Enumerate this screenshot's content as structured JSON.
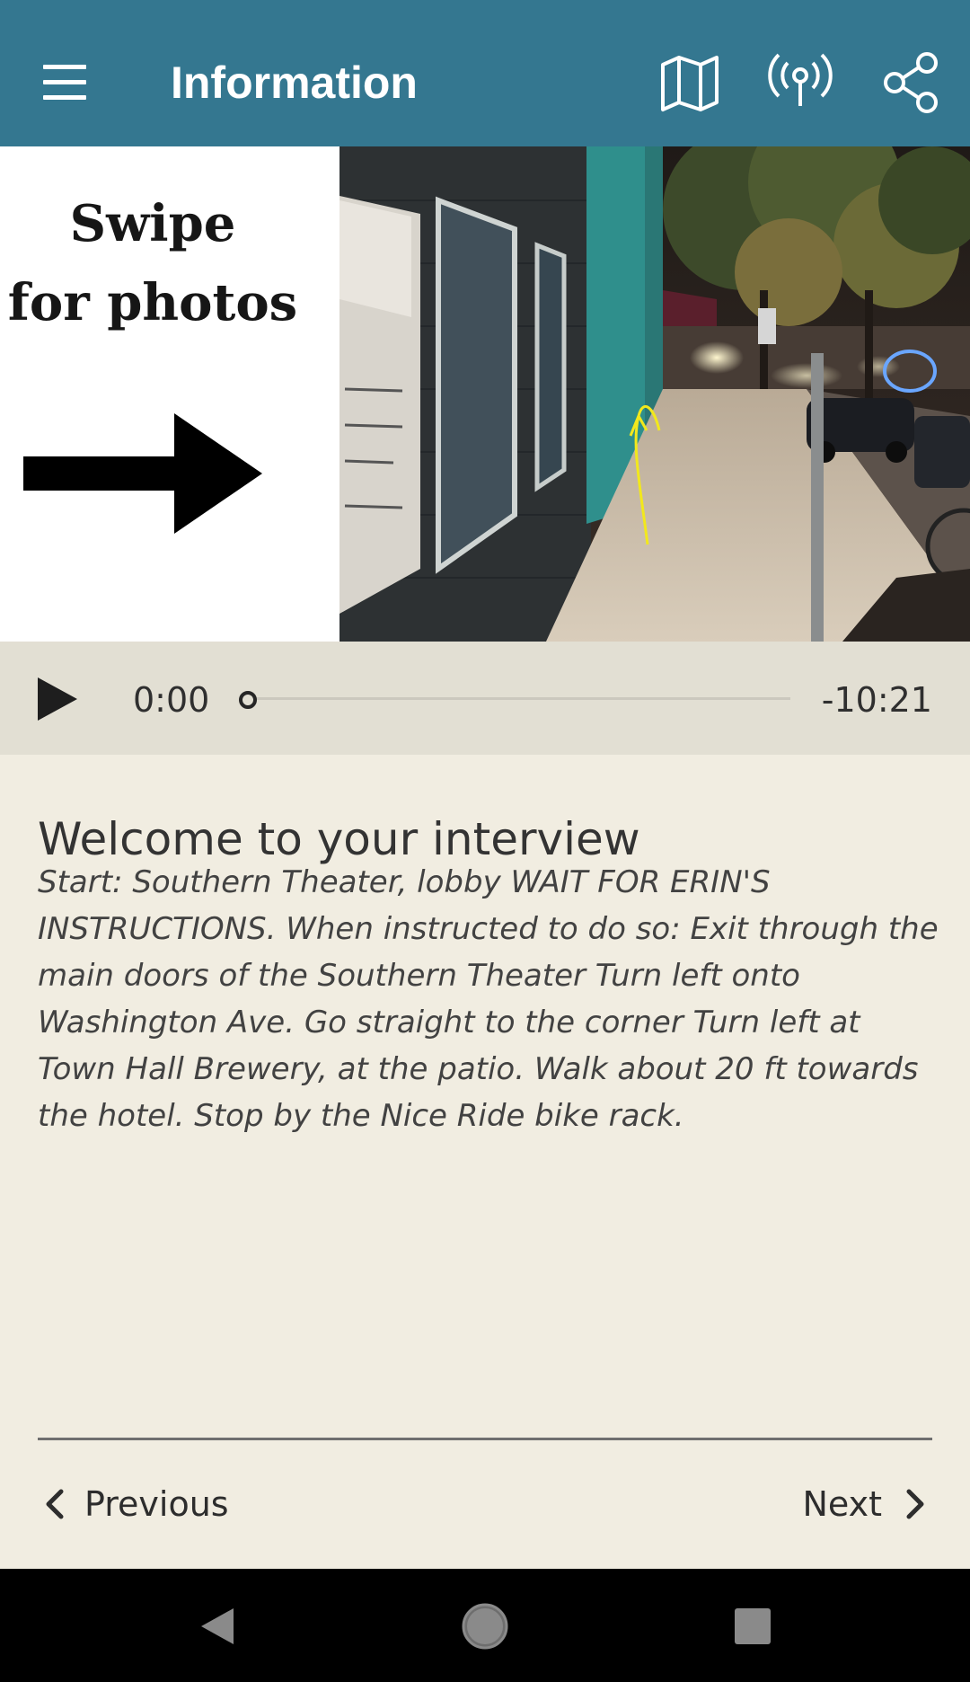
{
  "app_bar": {
    "title": "Information",
    "background": "#347790",
    "icons": [
      "menu-icon",
      "map-icon",
      "broadcast-icon",
      "share-icon"
    ]
  },
  "photo_card": {
    "swipe_line1": "Swipe",
    "swipe_line2": "for photos",
    "arrow_icon": "right-arrow-icon"
  },
  "player": {
    "current_time": "0:00",
    "remaining_time": "-10:21",
    "progress": 0
  },
  "content": {
    "title": "Welcome to your interview",
    "body": "Start: Southern Theater, lobby WAIT FOR ERIN'S INSTRUCTIONS. When instructed to do so: Exit through the main doors of the Southern Theater Turn left onto Washington Ave. Go straight to the corner Turn left at Town Hall Brewery, at the patio. Walk about 20 ft towards the hotel. Stop by the Nice Ride bike rack."
  },
  "navigation": {
    "previous_label": "Previous",
    "next_label": "Next"
  },
  "system_nav": {
    "icons": [
      "back-icon",
      "home-icon",
      "recents-icon"
    ]
  }
}
